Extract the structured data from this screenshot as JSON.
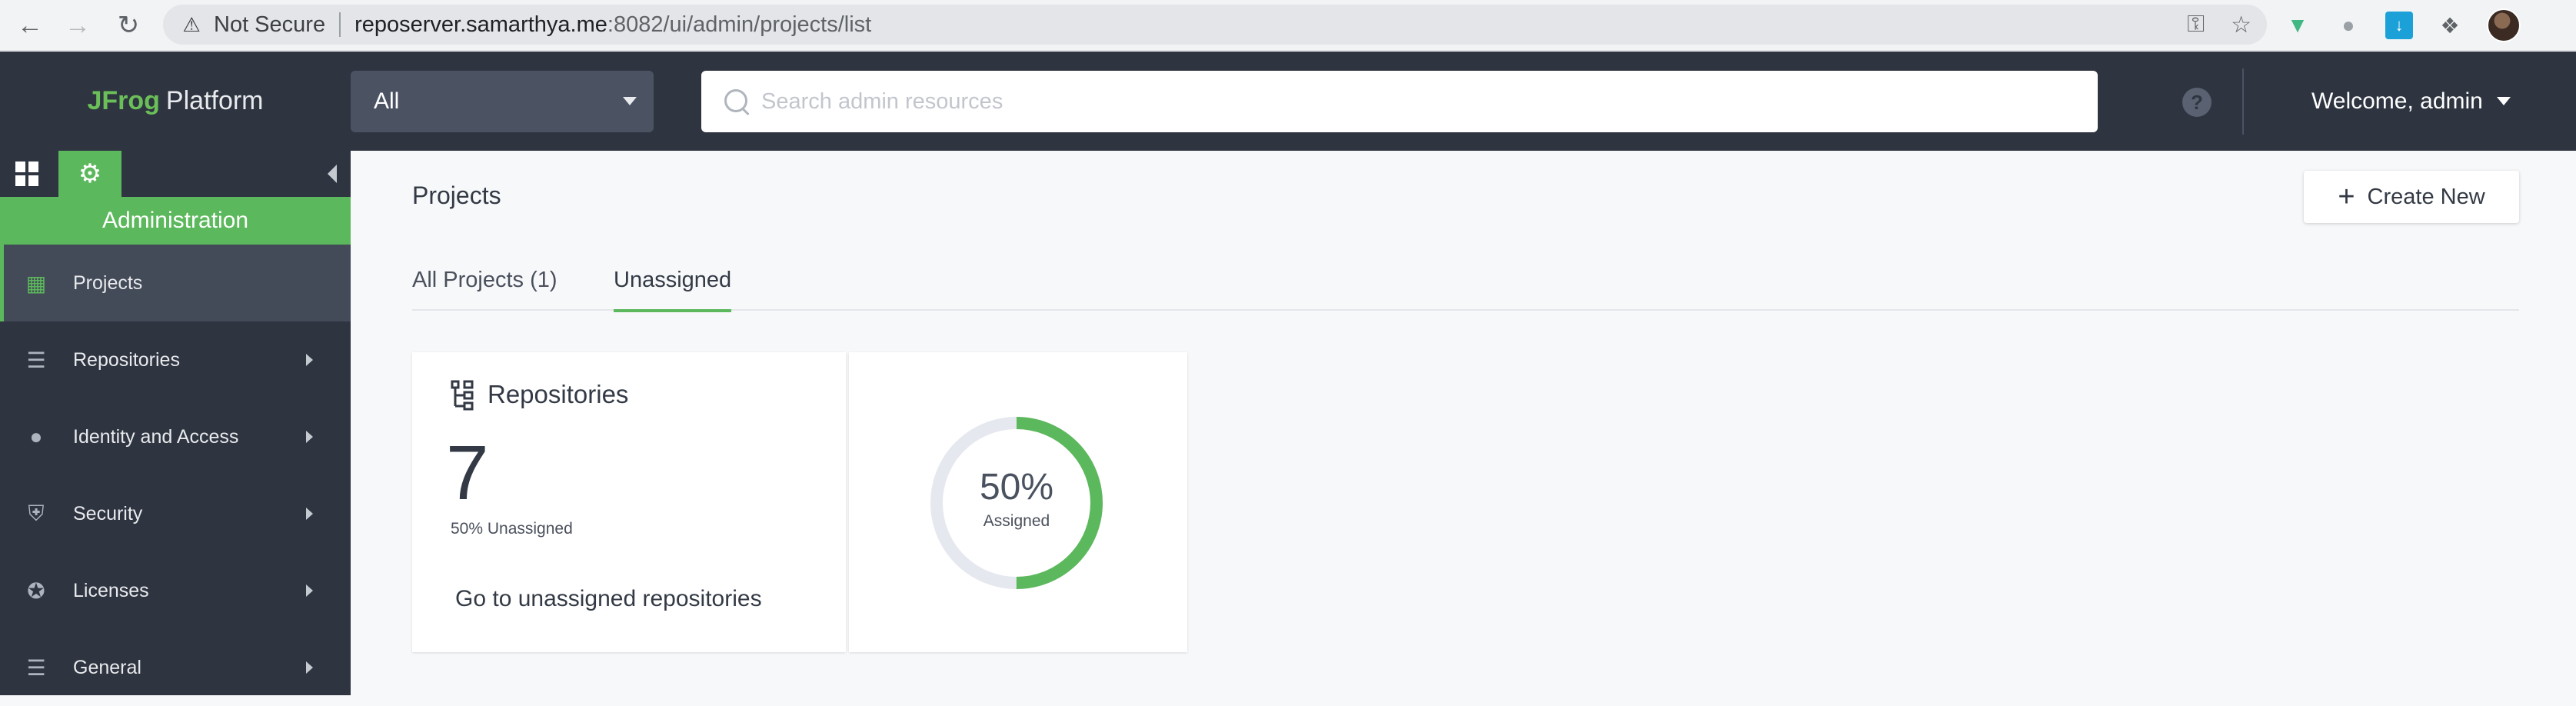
{
  "browser": {
    "not_secure": "Not Secure",
    "url_host": "reposerver.samarthya.me",
    "url_path": ":8082/ui/admin/projects/list"
  },
  "header": {
    "brand_jfrog": "JFrog",
    "brand_platform": "Platform",
    "scope_value": "All",
    "search_placeholder": "Search admin resources",
    "help": "?",
    "welcome": "Welcome, admin"
  },
  "sidebar": {
    "banner": "Administration",
    "items": [
      {
        "label": "Projects"
      },
      {
        "label": "Repositories"
      },
      {
        "label": "Identity and Access"
      },
      {
        "label": "Security"
      },
      {
        "label": "Licenses"
      },
      {
        "label": "General"
      }
    ]
  },
  "main": {
    "title": "Projects",
    "create_label": "Create New",
    "tabs": [
      {
        "label": "All Projects (1)"
      },
      {
        "label": "Unassigned"
      }
    ],
    "card": {
      "title": "Repositories",
      "count": "7",
      "note": "50% Unassigned",
      "link": "Go to unassigned repositories",
      "donut_pct": "50%",
      "donut_label": "Assigned",
      "assigned_fraction": 0.5
    }
  },
  "colors": {
    "accent": "#5cb85c",
    "header_bg": "#2e3440",
    "donut_track": "#e6e8f0"
  }
}
